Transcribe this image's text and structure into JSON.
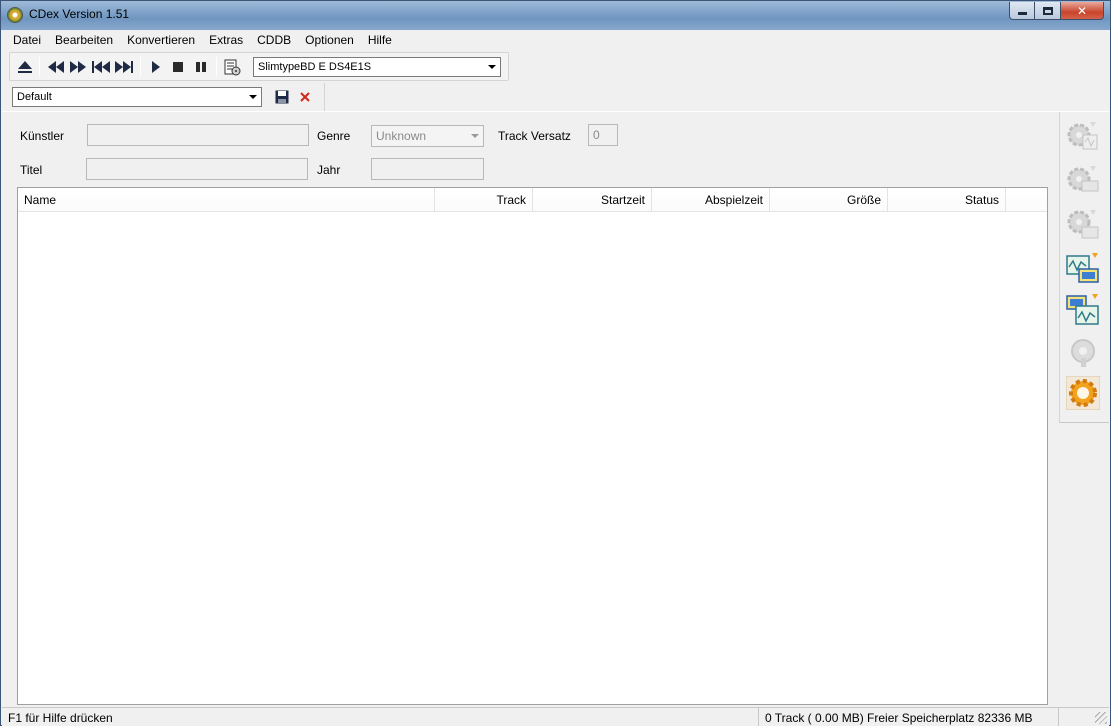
{
  "window": {
    "title": "CDex Version 1.51"
  },
  "menu": [
    "Datei",
    "Bearbeiten",
    "Konvertieren",
    "Extras",
    "CDDB",
    "Optionen",
    "Hilfe"
  ],
  "toolbar": {
    "drive": "SlimtypeBD  E  DS4E1S",
    "profile": "Default"
  },
  "form": {
    "artist_label": "Künstler",
    "artist_value": "",
    "title_label": "Titel",
    "title_value": "",
    "genre_label": "Genre",
    "genre_value": "Unknown",
    "year_label": "Jahr",
    "year_value": "",
    "offset_label": "Track Versatz",
    "offset_value": "0"
  },
  "tracklist": {
    "columns": [
      "Name",
      "Track",
      "Startzeit",
      "Abspielzeit",
      "Größe",
      "Status"
    ],
    "rows": []
  },
  "sidebar": {
    "icons": [
      "extract-cd-to-wav-icon",
      "extract-cd-to-mp3-icon",
      "extract-partial-icon",
      "convert-wav-to-mp3-icon",
      "convert-mp3-to-wav-icon",
      "help-icon",
      "settings-icon"
    ]
  },
  "status": {
    "left": "F1 für Hilfe drücken",
    "right": "0 Track ( 0.00 MB) Freier Speicherplatz 82336 MB"
  },
  "colors": {
    "titlebar": "#7fa2c9",
    "close_button": "#c8452d",
    "background": "#f0f0f0"
  }
}
